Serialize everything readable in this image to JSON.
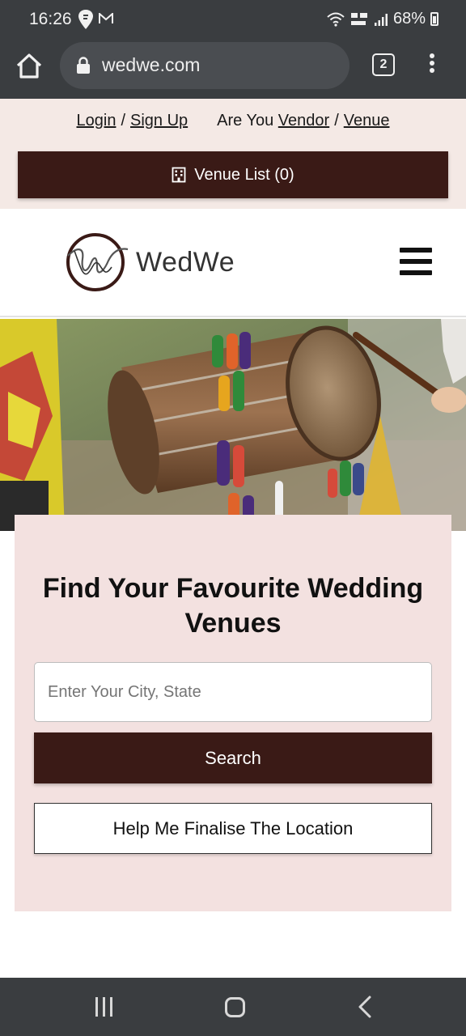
{
  "status_bar": {
    "time": "16:26",
    "battery": "68%",
    "icons": [
      "swiggy-icon",
      "gmail-icon",
      "wifi-icon",
      "volte-icon",
      "signal-icon",
      "battery-icon"
    ]
  },
  "browser": {
    "url": "wedwe.com",
    "tab_count": "2"
  },
  "top_links": {
    "login": "Login",
    "slash1": "/",
    "signup": "Sign Up",
    "vendor_prefix": "Are You",
    "vendor": "Vendor",
    "slash2": "/",
    "venue": "Venue"
  },
  "venue_list_button": "Venue List (0)",
  "logo": {
    "text": "WedWe"
  },
  "search_card": {
    "title": "Find Your Favourite Wedding Venues",
    "city_placeholder": "Enter Your City, State",
    "city_value": "",
    "search_label": "Search",
    "help_label": "Help Me Finalise The Location"
  },
  "colors": {
    "brand_dark": "#3a1a16",
    "top_strip_bg": "#f4e9e5",
    "card_bg": "#f3e1e0",
    "system_bar": "#3a3d40"
  }
}
